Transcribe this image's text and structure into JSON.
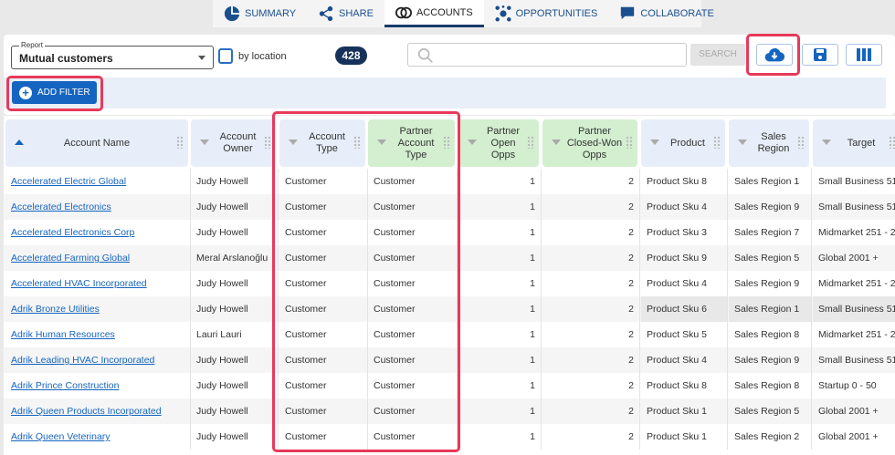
{
  "tabs": [
    {
      "label": "SUMMARY",
      "icon": "pie-chart-icon"
    },
    {
      "label": "SHARE",
      "icon": "share-icon"
    },
    {
      "label": "ACCOUNTS",
      "icon": "overlap-circles-icon",
      "active": true
    },
    {
      "label": "OPPORTUNITIES",
      "icon": "network-icon"
    },
    {
      "label": "COLLABORATE",
      "icon": "chat-icon"
    }
  ],
  "toolbar": {
    "report_label": "Report",
    "report_value": "Mutual customers",
    "by_location": "by location",
    "count": "428",
    "search_placeholder": "",
    "search_button": "SEARCH",
    "add_filter": "ADD FILTER",
    "download_icon": "cloud-download-icon",
    "save_icon": "save-icon",
    "columns_icon": "columns-icon"
  },
  "columns": [
    "Account Name",
    "Account Owner",
    "Account Type",
    "Partner Account Type",
    "Partner Open Opps",
    "Partner Closed-Won Opps",
    "Product",
    "Sales Region",
    "Target"
  ],
  "rows": [
    [
      "Accelerated Electric Global",
      "Judy Howell",
      "Customer",
      "Customer",
      "1",
      "2",
      "Product Sku 8",
      "Sales Region 1",
      "Small Business 51"
    ],
    [
      "Accelerated Electronics",
      "Judy Howell",
      "Customer",
      "Customer",
      "1",
      "2",
      "Product Sku 4",
      "Sales Region 9",
      "Small Business 51"
    ],
    [
      "Accelerated Electronics Corp",
      "Judy Howell",
      "Customer",
      "Customer",
      "1",
      "2",
      "Product Sku 3",
      "Sales Region 7",
      "Midmarket 251 - 2"
    ],
    [
      "Accelerated Farming Global",
      "Meral Arslanoğlu",
      "Customer",
      "Customer",
      "1",
      "2",
      "Product Sku 9",
      "Sales Region 5",
      "Global 2001 +"
    ],
    [
      "Accelerated HVAC Incorporated",
      "Judy Howell",
      "Customer",
      "Customer",
      "1",
      "2",
      "Product Sku 4",
      "Sales Region 9",
      "Midmarket 251 - 2"
    ],
    [
      "Adrik Bronze Utilities",
      "Judy Howell",
      "Customer",
      "Customer",
      "1",
      "2",
      "Product Sku 6",
      "Sales Region 1",
      "Small Business 51"
    ],
    [
      "Adrik Human Resources",
      "Lauri Lauri",
      "Customer",
      "Customer",
      "1",
      "2",
      "Product Sku 5",
      "Sales Region 8",
      "Midmarket 251 - 2"
    ],
    [
      "Adrik Leading HVAC Incorporated",
      "Judy Howell",
      "Customer",
      "Customer",
      "1",
      "2",
      "Product Sku 4",
      "Sales Region 9",
      "Small Business 51"
    ],
    [
      "Adrik Prince Construction",
      "Judy Howell",
      "Customer",
      "Customer",
      "1",
      "2",
      "Product Sku 8",
      "Sales Region 8",
      "Startup 0 - 50"
    ],
    [
      "Adrik Queen Products Incorporated",
      "Judy Howell",
      "Customer",
      "Customer",
      "1",
      "2",
      "Product Sku 1",
      "Sales Region 5",
      "Global 2001 +"
    ],
    [
      "Adrik Queen Veterinary",
      "Judy Howell",
      "Customer",
      "Customer",
      "1",
      "2",
      "Product Sku 1",
      "Sales Region 2",
      "Global 2001 +"
    ]
  ],
  "colors": {
    "accent": "#1565c0",
    "highlight": "#e8395a",
    "partner_header": "#d3efd0",
    "header": "#e7eef9",
    "badge": "#17325a"
  }
}
